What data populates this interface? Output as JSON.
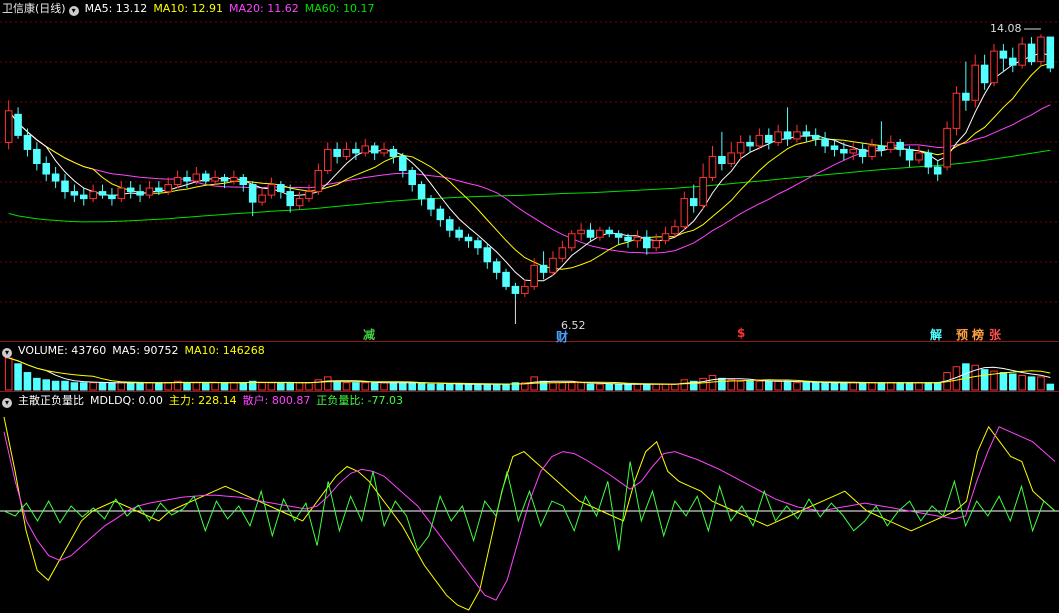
{
  "price_header": {
    "name": "卫信康(日线)",
    "ma5": "MA5: 13.12",
    "ma10": "MA10: 12.91",
    "ma20": "MA20: 11.62",
    "ma60": "MA60: 10.17"
  },
  "volume_header": {
    "name": "VOLUME: 43760",
    "ma5": "MA5: 90752",
    "ma10": "MA10: 146268"
  },
  "indicator_header": {
    "name": "主散正负量比",
    "mdldq": "MDLDQ: 0.00",
    "main": "主力: 228.14",
    "retail": "散户: 800.87",
    "ratio": "正负量比: -77.03"
  },
  "annotations": {
    "high": "14.08",
    "low": "6.52",
    "event_jian": "减",
    "event_cai": "财",
    "event_dollar": "$",
    "event_jie": "解",
    "event_yu": "预",
    "event_bang": "榜",
    "event_zhang": "张"
  },
  "colors": {
    "up": "#ff3232",
    "down": "#54ffff",
    "ma5": "#ffffff",
    "ma10": "#ffff00",
    "ma20": "#ff44ff",
    "ma60": "#00e000",
    "grid": "#7a0000",
    "main_line": "#ffff00",
    "retail_line": "#ff44ff",
    "ratio_line": "#40ff40",
    "zero_line": "#ffffff"
  },
  "chart_data": [
    {
      "type": "candlestick",
      "title": "卫信康(日线)",
      "ylim": [
        6.0,
        14.6
      ],
      "high_label": 14.08,
      "low_label": 6.52,
      "candles": [
        [
          11.0,
          11.9,
          10.8,
          12.2
        ],
        [
          11.8,
          11.2,
          11.1,
          12.0
        ],
        [
          11.2,
          10.8,
          10.6,
          11.4
        ],
        [
          10.8,
          10.4,
          10.2,
          11.0
        ],
        [
          10.4,
          10.1,
          9.9,
          10.6
        ],
        [
          10.1,
          9.9,
          9.7,
          10.3
        ],
        [
          9.9,
          9.6,
          9.4,
          10.1
        ],
        [
          9.6,
          9.5,
          9.3,
          9.8
        ],
        [
          9.5,
          9.4,
          9.2,
          9.7
        ],
        [
          9.4,
          9.6,
          9.3,
          9.8
        ],
        [
          9.6,
          9.5,
          9.4,
          9.8
        ],
        [
          9.5,
          9.4,
          9.2,
          9.7
        ],
        [
          9.4,
          9.7,
          9.3,
          9.9
        ],
        [
          9.7,
          9.6,
          9.4,
          9.9
        ],
        [
          9.6,
          9.5,
          9.3,
          9.8
        ],
        [
          9.5,
          9.7,
          9.4,
          9.9
        ],
        [
          9.7,
          9.6,
          9.5,
          9.9
        ],
        [
          9.6,
          9.8,
          9.5,
          10.0
        ],
        [
          9.8,
          10.0,
          9.7,
          10.2
        ],
        [
          10.0,
          9.9,
          9.7,
          10.2
        ],
        [
          9.9,
          10.1,
          9.8,
          10.3
        ],
        [
          10.1,
          9.9,
          9.8,
          10.2
        ],
        [
          9.9,
          10.0,
          9.8,
          10.2
        ],
        [
          10.0,
          9.9,
          9.7,
          10.1
        ],
        [
          9.9,
          10.0,
          9.8,
          10.2
        ],
        [
          10.0,
          9.8,
          9.6,
          10.1
        ],
        [
          9.8,
          9.3,
          8.9,
          9.9
        ],
        [
          9.3,
          9.5,
          9.2,
          9.7
        ],
        [
          9.5,
          9.8,
          9.4,
          10.0
        ],
        [
          9.8,
          9.6,
          9.4,
          9.9
        ],
        [
          9.6,
          9.2,
          9.0,
          9.8
        ],
        [
          9.2,
          9.4,
          9.1,
          9.6
        ],
        [
          9.4,
          9.6,
          9.3,
          9.8
        ],
        [
          9.6,
          10.2,
          9.5,
          10.4
        ],
        [
          10.2,
          10.8,
          10.1,
          11.0
        ],
        [
          10.8,
          10.6,
          10.4,
          11.0
        ],
        [
          10.6,
          10.8,
          10.5,
          11.0
        ],
        [
          10.8,
          10.7,
          10.5,
          11.0
        ],
        [
          10.7,
          10.9,
          10.6,
          11.1
        ],
        [
          10.9,
          10.7,
          10.5,
          11.0
        ],
        [
          10.7,
          10.8,
          10.6,
          11.0
        ],
        [
          10.8,
          10.6,
          10.4,
          10.9
        ],
        [
          10.6,
          10.2,
          10.0,
          10.7
        ],
        [
          10.2,
          9.8,
          9.6,
          10.3
        ],
        [
          9.8,
          9.4,
          9.2,
          9.9
        ],
        [
          9.4,
          9.1,
          8.9,
          9.5
        ],
        [
          9.1,
          8.8,
          8.6,
          9.2
        ],
        [
          8.8,
          8.5,
          8.3,
          8.9
        ],
        [
          8.5,
          8.3,
          8.2,
          8.6
        ],
        [
          8.3,
          8.2,
          8.0,
          8.4
        ],
        [
          8.2,
          8.0,
          7.8,
          8.3
        ],
        [
          8.0,
          7.6,
          7.4,
          8.1
        ],
        [
          7.6,
          7.3,
          7.1,
          7.7
        ],
        [
          7.3,
          6.9,
          6.8,
          7.4
        ],
        [
          6.9,
          6.7,
          6.52,
          7.0
        ],
        [
          6.7,
          6.9,
          6.6,
          7.1
        ],
        [
          6.9,
          7.5,
          6.8,
          7.7
        ],
        [
          7.5,
          7.3,
          7.1,
          7.9
        ],
        [
          7.3,
          7.7,
          7.2,
          7.9
        ],
        [
          7.7,
          8.0,
          7.6,
          8.2
        ],
        [
          8.0,
          8.4,
          7.9,
          8.5
        ],
        [
          8.4,
          8.5,
          8.2,
          8.7
        ],
        [
          8.5,
          8.3,
          8.2,
          8.7
        ],
        [
          8.3,
          8.5,
          8.2,
          8.6
        ],
        [
          8.5,
          8.4,
          8.3,
          8.6
        ],
        [
          8.4,
          8.3,
          8.1,
          8.5
        ],
        [
          8.3,
          8.2,
          8.0,
          8.4
        ],
        [
          8.2,
          8.3,
          8.0,
          8.5
        ],
        [
          8.3,
          8.0,
          7.8,
          8.5
        ],
        [
          8.0,
          8.2,
          7.9,
          8.4
        ],
        [
          8.2,
          8.4,
          8.1,
          8.6
        ],
        [
          8.4,
          8.6,
          8.3,
          8.8
        ],
        [
          8.6,
          9.4,
          8.5,
          9.6
        ],
        [
          9.4,
          9.2,
          9.0,
          9.8
        ],
        [
          9.2,
          10.0,
          9.1,
          10.4
        ],
        [
          10.0,
          10.6,
          9.9,
          10.9
        ],
        [
          10.6,
          10.4,
          10.2,
          11.3
        ],
        [
          10.4,
          10.7,
          10.3,
          11.0
        ],
        [
          10.7,
          11.0,
          10.5,
          11.2
        ],
        [
          11.0,
          10.9,
          10.7,
          11.2
        ],
        [
          10.9,
          11.2,
          10.8,
          11.4
        ],
        [
          11.2,
          11.0,
          10.8,
          11.4
        ],
        [
          11.0,
          11.3,
          10.9,
          11.5
        ],
        [
          11.3,
          11.1,
          10.9,
          12.0
        ],
        [
          11.1,
          11.3,
          11.0,
          11.5
        ],
        [
          11.3,
          11.2,
          11.0,
          11.5
        ],
        [
          11.2,
          11.1,
          10.9,
          11.4
        ],
        [
          11.1,
          10.9,
          10.7,
          11.3
        ],
        [
          10.9,
          10.8,
          10.6,
          11.1
        ],
        [
          10.8,
          10.7,
          10.5,
          11.0
        ],
        [
          10.7,
          10.8,
          10.5,
          11.0
        ],
        [
          10.8,
          10.6,
          10.4,
          11.0
        ],
        [
          10.6,
          10.9,
          10.5,
          11.1
        ],
        [
          10.9,
          10.8,
          10.6,
          11.6
        ],
        [
          10.8,
          11.0,
          10.7,
          11.2
        ],
        [
          11.0,
          10.8,
          10.6,
          11.1
        ],
        [
          10.8,
          10.5,
          10.3,
          10.9
        ],
        [
          10.5,
          10.7,
          10.4,
          10.9
        ],
        [
          10.7,
          10.3,
          10.1,
          10.8
        ],
        [
          10.3,
          10.1,
          9.9,
          10.5
        ],
        [
          10.3,
          11.4,
          10.2,
          11.6
        ],
        [
          11.4,
          12.4,
          11.2,
          12.6
        ],
        [
          12.4,
          12.2,
          11.9,
          13.3
        ],
        [
          12.2,
          13.2,
          12.0,
          13.5
        ],
        [
          13.2,
          12.7,
          12.5,
          13.5
        ],
        [
          12.7,
          13.6,
          12.6,
          13.8
        ],
        [
          13.6,
          13.4,
          13.0,
          13.8
        ],
        [
          13.4,
          13.2,
          13.0,
          13.7
        ],
        [
          13.2,
          13.8,
          13.1,
          14.0
        ],
        [
          13.8,
          13.3,
          13.2,
          14.0
        ],
        [
          13.3,
          14.0,
          13.2,
          14.08
        ],
        [
          14.0,
          13.12,
          13.0,
          14.0
        ]
      ]
    },
    {
      "type": "bar",
      "title": "VOLUME",
      "values_scale": "relative",
      "volumes": [
        2.2,
        1.8,
        1.2,
        0.8,
        0.7,
        0.6,
        0.6,
        0.5,
        0.5,
        0.5,
        0.5,
        0.5,
        0.5,
        0.5,
        0.5,
        0.5,
        0.5,
        0.5,
        0.6,
        0.5,
        0.5,
        0.5,
        0.5,
        0.5,
        0.5,
        0.5,
        0.6,
        0.5,
        0.5,
        0.5,
        0.5,
        0.5,
        0.5,
        0.7,
        0.9,
        0.6,
        0.5,
        0.5,
        0.5,
        0.5,
        0.5,
        0.5,
        0.5,
        0.5,
        0.5,
        0.4,
        0.4,
        0.4,
        0.4,
        0.4,
        0.4,
        0.4,
        0.4,
        0.4,
        0.5,
        0.5,
        0.9,
        0.6,
        0.5,
        0.5,
        0.5,
        0.5,
        0.4,
        0.4,
        0.4,
        0.4,
        0.4,
        0.4,
        0.4,
        0.4,
        0.4,
        0.4,
        0.7,
        0.6,
        0.8,
        1.0,
        0.8,
        0.7,
        0.6,
        0.6,
        0.6,
        0.6,
        0.6,
        0.6,
        0.5,
        0.5,
        0.5,
        0.5,
        0.5,
        0.5,
        0.5,
        0.5,
        0.5,
        0.5,
        0.5,
        0.5,
        0.5,
        0.5,
        0.5,
        0.5,
        1.2,
        1.6,
        1.8,
        1.7,
        1.4,
        1.3,
        1.2,
        1.1,
        1.0,
        0.9,
        0.9,
        0.4
      ]
    },
    {
      "type": "line",
      "title": "主散正负量比",
      "ylim": [
        -100,
        100
      ],
      "series": [
        {
          "name": "主力",
          "color": "#ffff00",
          "values": [
            95,
            40,
            -20,
            -60,
            -70,
            -50,
            -30,
            -10,
            0,
            5,
            10,
            5,
            0,
            -5,
            -10,
            0,
            5,
            10,
            15,
            20,
            25,
            20,
            15,
            10,
            5,
            0,
            -5,
            -10,
            5,
            20,
            35,
            45,
            40,
            30,
            15,
            0,
            -15,
            -35,
            -55,
            -70,
            -85,
            -95,
            -100,
            -80,
            -30,
            20,
            55,
            60,
            50,
            40,
            30,
            20,
            10,
            5,
            0,
            -5,
            -10,
            30,
            60,
            70,
            40,
            30,
            25,
            20,
            10,
            5,
            0,
            -5,
            -10,
            -15,
            -10,
            -5,
            0,
            5,
            10,
            15,
            20,
            10,
            0,
            -5,
            -10,
            -15,
            -20,
            -15,
            -10,
            -5,
            0,
            10,
            60,
            85,
            70,
            55,
            50,
            20,
            10,
            0
          ]
        },
        {
          "name": "散户",
          "color": "#ff44ff",
          "values": [
            80,
            30,
            -10,
            -30,
            -45,
            -50,
            -45,
            -35,
            -25,
            -15,
            -8,
            0,
            5,
            8,
            10,
            12,
            14,
            15,
            16,
            16,
            15,
            14,
            12,
            10,
            8,
            6,
            4,
            2,
            5,
            15,
            28,
            38,
            42,
            40,
            35,
            25,
            15,
            5,
            -10,
            -25,
            -40,
            -55,
            -70,
            -85,
            -90,
            -70,
            -30,
            10,
            40,
            55,
            60,
            58,
            52,
            45,
            38,
            30,
            22,
            30,
            45,
            58,
            60,
            56,
            52,
            47,
            42,
            36,
            30,
            24,
            18,
            12,
            8,
            4,
            2,
            0,
            2,
            4,
            6,
            8,
            6,
            4,
            2,
            0,
            -2,
            -4,
            -6,
            -8,
            -5,
            30,
            60,
            85,
            80,
            75,
            70,
            60,
            50
          ]
        },
        {
          "name": "正负量比",
          "color": "#40ff40",
          "values": [
            0,
            -5,
            8,
            -10,
            10,
            -12,
            5,
            -6,
            3,
            -8,
            12,
            -5,
            6,
            -10,
            8,
            -4,
            2,
            15,
            -20,
            10,
            -8,
            5,
            -15,
            20,
            -25,
            12,
            -10,
            8,
            -35,
            30,
            -20,
            15,
            -10,
            40,
            -15,
            10,
            -5,
            -40,
            -25,
            15,
            -10,
            5,
            -30,
            10,
            -5,
            40,
            -10,
            20,
            -15,
            10,
            5,
            -20,
            15,
            -5,
            30,
            -40,
            50,
            -10,
            20,
            -25,
            10,
            -5,
            15,
            -20,
            25,
            -10,
            5,
            -15,
            20,
            -10,
            5,
            -8,
            12,
            -6,
            8,
            -4,
            -20,
            -10,
            5,
            -15,
            0,
            10,
            -10,
            5,
            -5,
            30,
            -15,
            10,
            -5,
            15,
            -10,
            25,
            -20,
            10,
            0
          ]
        },
        {
          "name": "MDLDQ",
          "color": "#ffffff",
          "values": [
            0
          ]
        }
      ]
    }
  ]
}
